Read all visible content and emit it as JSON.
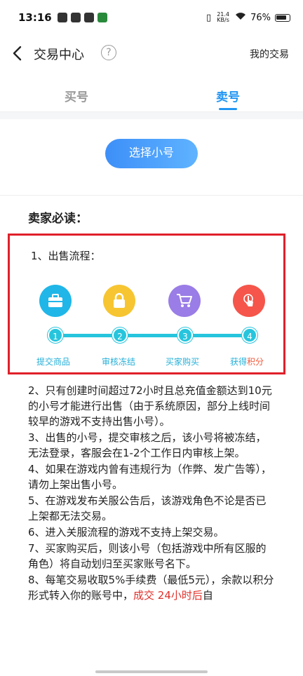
{
  "status_bar": {
    "time": "13:16",
    "net_speed_value": "21.4",
    "net_speed_unit": "KB/s",
    "battery": "76%"
  },
  "nav": {
    "title": "交易中心",
    "help_glyph": "?",
    "right_link": "我的交易"
  },
  "tabs": [
    {
      "label": "买号",
      "active": false
    },
    {
      "label": "卖号",
      "active": true
    }
  ],
  "select_button": "选择小号",
  "section_title": "卖家必读：",
  "process": {
    "heading": "1、出售流程：",
    "steps": [
      {
        "num": "1",
        "label": "提交商品",
        "icon": "briefcase-icon"
      },
      {
        "num": "2",
        "label": "审核冻结",
        "icon": "lock-icon"
      },
      {
        "num": "3",
        "label": "买家购买",
        "icon": "cart-icon"
      },
      {
        "num": "4",
        "label_a": "获得",
        "label_b": "积分",
        "icon": "hand-tap-icon"
      }
    ]
  },
  "rules": [
    "2、只有创建时间超过72小时且总充值金额达到10元的小号才能进行出售（由于系统原因，部分上线时间较早的游戏不支持出售小号）。",
    "3、出售的小号，提交审核之后，该小号将被冻结，无法登录，客服会在1-2个工作日内审核上架。",
    "4、如果在游戏内曾有违规行为（作弊、发广告等），请勿上架出售小号。",
    "5、在游戏发布关服公告后，该游戏角色不论是否已上架都无法交易。",
    "6、进入关服流程的游戏不支持上架交易。",
    "7、买家购买后，则该小号（包括游戏中所有区服的角色）将自动划归至买家账号名下。"
  ],
  "rule8": {
    "text": "8、每笔交易收取5%手续费（最低5元），余款以积分形式转入你的账号中，",
    "highlight": "成交 24小时后",
    "tail": "自"
  },
  "colors": {
    "accent": "#2196f3",
    "highlight_red": "#e0202a",
    "step_teal": "#26c5dd"
  }
}
